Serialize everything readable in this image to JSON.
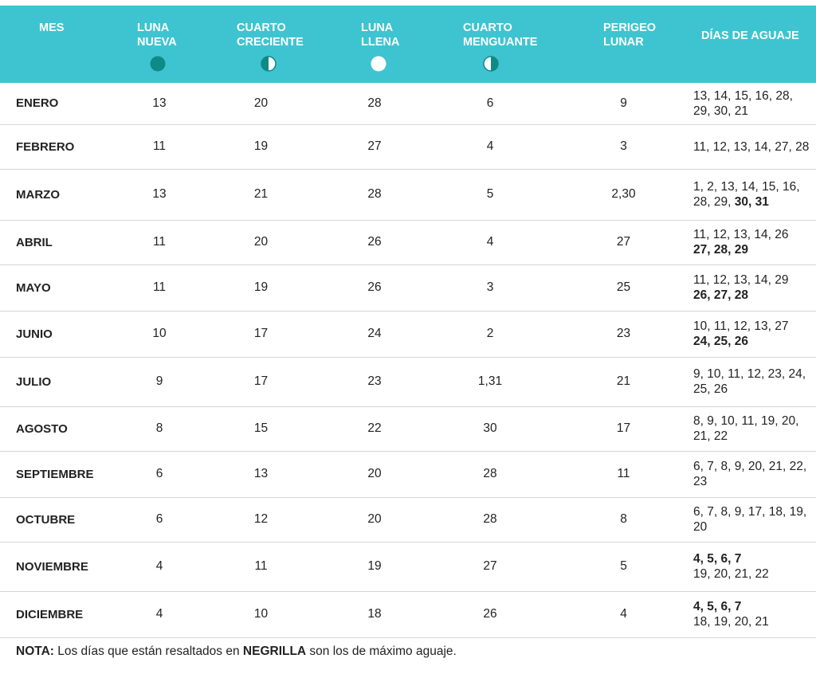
{
  "header": {
    "month": "MES",
    "new_moon": "LUNA\nNUEVA",
    "first_quarter": "CUARTO\nCRECIENTE",
    "full_moon": "LUNA\nLLENA",
    "last_quarter": "CUARTO\nMENGUANTE",
    "perigee": "PERIGEO\nLUNAR",
    "tide_days": "DÍAS DE AGUAJE"
  },
  "icons": {
    "new_moon": "new-moon-icon",
    "first_quarter": "first-quarter-moon-icon",
    "full_moon": "full-moon-icon",
    "last_quarter": "last-quarter-moon-icon"
  },
  "colors": {
    "header_bg": "#3ec4d0",
    "moon_dark": "#0f8a86",
    "white": "#ffffff"
  },
  "rows": [
    {
      "month": "ENERO",
      "new": "13",
      "first": "20",
      "full": "28",
      "last": "6",
      "perigee": "9",
      "tide_normal_1": "13, 14, 15, 16, 28, 29, 30, 21",
      "tide_bold": "",
      "tide_normal_2": ""
    },
    {
      "month": "FEBRERO",
      "new": "11",
      "first": "19",
      "full": "27",
      "last": "4",
      "perigee": "3",
      "tide_normal_1": "11, 12, 13, 14, 27, 28",
      "tide_bold": "",
      "tide_normal_2": ""
    },
    {
      "month": "MARZO",
      "new": "13",
      "first": "21",
      "full": "28",
      "last": "5",
      "perigee": "2,30",
      "tide_normal_1": "1, 2, 13, 14, 15, 16, 28, 29, ",
      "tide_bold": "30, 31",
      "tide_normal_2": ""
    },
    {
      "month": "ABRIL",
      "new": "11",
      "first": "20",
      "full": "26",
      "last": "4",
      "perigee": "27",
      "tide_normal_1": "11, 12, 13, 14, 26",
      "tide_bold": "27, 28, 29",
      "tide_normal_2": ""
    },
    {
      "month": "MAYO",
      "new": "11",
      "first": "19",
      "full": "26",
      "last": "3",
      "perigee": "25",
      "tide_normal_1": "11, 12, 13, 14, 29",
      "tide_bold": "26, 27, 28",
      "tide_normal_2": ""
    },
    {
      "month": "JUNIO",
      "new": "10",
      "first": "17",
      "full": "24",
      "last": "2",
      "perigee": "23",
      "tide_normal_1": "10, 11, 12, 13, 27",
      "tide_bold": "24, 25, 26",
      "tide_normal_2": ""
    },
    {
      "month": "JULIO",
      "new": "9",
      "first": "17",
      "full": "23",
      "last": "1,31",
      "perigee": "21",
      "tide_normal_1": "9, 10, 11, 12, 23, 24, 25, 26",
      "tide_bold": "",
      "tide_normal_2": ""
    },
    {
      "month": "AGOSTO",
      "new": "8",
      "first": "15",
      "full": "22",
      "last": "30",
      "perigee": "17",
      "tide_normal_1": "8, 9, 10, 11, 19, 20, 21, 22",
      "tide_bold": "",
      "tide_normal_2": ""
    },
    {
      "month": "SEPTIEMBRE",
      "new": "6",
      "first": "13",
      "full": "20",
      "last": "28",
      "perigee": "11",
      "tide_normal_1": "6, 7, 8, 9, 20, 21, 22, 23",
      "tide_bold": "",
      "tide_normal_2": ""
    },
    {
      "month": "OCTUBRE",
      "new": "6",
      "first": "12",
      "full": "20",
      "last": "28",
      "perigee": "8",
      "tide_normal_1": "6, 7, 8, 9, 17, 18, 19, 20",
      "tide_bold": "",
      "tide_normal_2": ""
    },
    {
      "month": "NOVIEMBRE",
      "new": "4",
      "first": "11",
      "full": "19",
      "last": "27",
      "perigee": "5",
      "tide_normal_1": "",
      "tide_bold": "4, 5, 6, 7",
      "tide_normal_2": "19, 20, 21, 22"
    },
    {
      "month": "DICIEMBRE",
      "new": "4",
      "first": "10",
      "full": "18",
      "last": "26",
      "perigee": "4",
      "tide_normal_1": "",
      "tide_bold": "4, 5, 6, 7",
      "tide_normal_2": "18, 19, 20, 21"
    }
  ],
  "note": {
    "label": "NOTA:",
    "text_1": " Los días que están resaltados en ",
    "bold_word": "NEGRILLA",
    "text_2": " son los de máximo aguaje."
  }
}
